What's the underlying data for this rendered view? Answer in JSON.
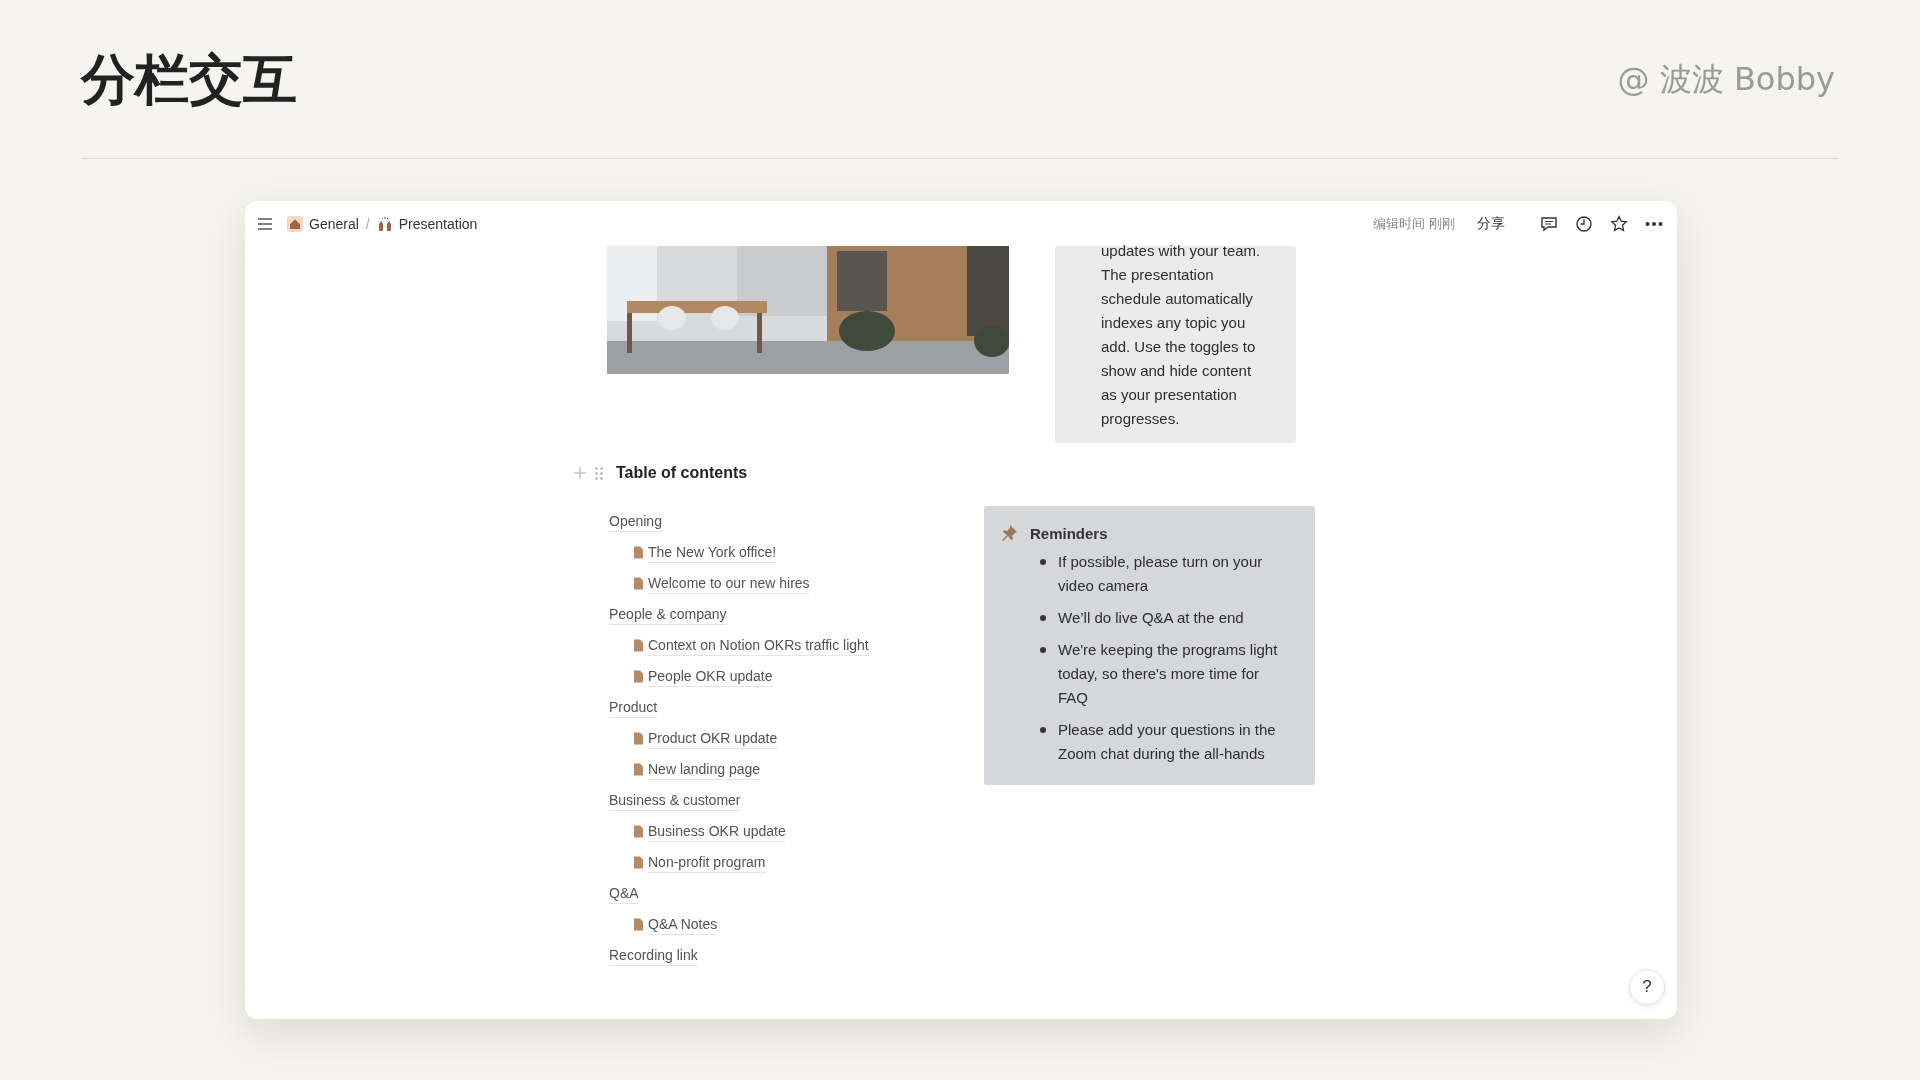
{
  "slide": {
    "title": "分栏交互",
    "author": "@ 波波 Bobby"
  },
  "breadcrumb_separator": "/",
  "breadcrumb": [
    {
      "label": "General"
    },
    {
      "label": "Presentation"
    }
  ],
  "topbar": {
    "edited": "编辑时间 刚刚",
    "share": "分享"
  },
  "intro_callout": {
    "lines": [
      "updates with your team.",
      "The presentation",
      "schedule automatically",
      "indexes any topic you",
      "add. Use the toggles to",
      "show and hide content",
      "as your presentation",
      "progresses."
    ]
  },
  "toc": {
    "title": "Table of contents",
    "items": [
      {
        "label": "Opening",
        "children": [
          {
            "label": "The New York office!"
          },
          {
            "label": "Welcome to our new hires"
          }
        ]
      },
      {
        "label": "People & company",
        "children": [
          {
            "label": "Context on Notion OKRs traffic light"
          },
          {
            "label": "People OKR update"
          }
        ]
      },
      {
        "label": "Product",
        "children": [
          {
            "label": "Product OKR update"
          },
          {
            "label": "New landing page"
          }
        ]
      },
      {
        "label": "Business & customer",
        "children": [
          {
            "label": "Business OKR update"
          },
          {
            "label": "Non-profit program"
          }
        ]
      },
      {
        "label": "Q&A",
        "children": [
          {
            "label": "Q&A Notes"
          }
        ]
      },
      {
        "label": "Recording link"
      }
    ]
  },
  "reminders": {
    "title": "Reminders",
    "items": [
      "If possible, please turn on your video camera",
      "We’ll do live Q&A at the end",
      "We're keeping the programs light today, so there's more time for FAQ",
      "Please add your questions in the Zoom chat during the all-hands"
    ]
  },
  "help": {
    "label": "?"
  }
}
